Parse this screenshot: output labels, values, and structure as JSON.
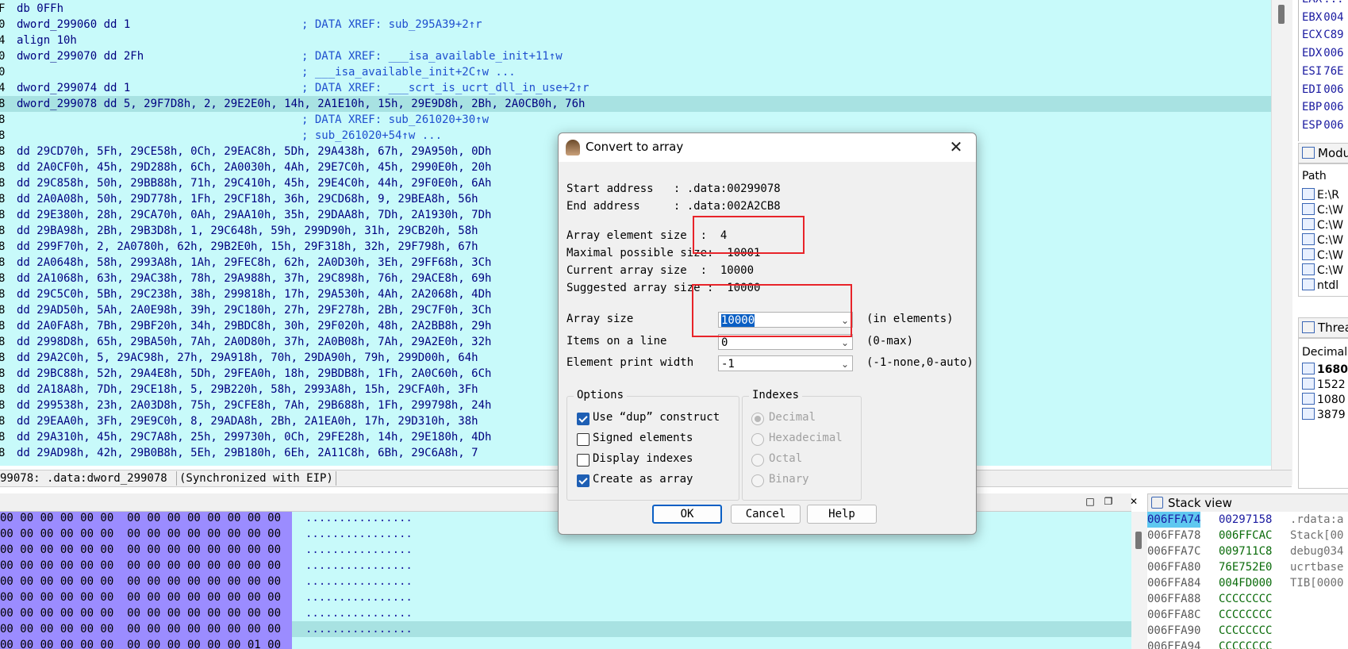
{
  "disasm": {
    "lines": [
      {
        "addr": "F",
        "code": "db 0FFh",
        "comment": ""
      },
      {
        "addr": "0",
        "code": "dword_299060 dd 1",
        "comment": "; DATA XREF: sub_295A39+2↑r"
      },
      {
        "addr": "4",
        "code": "align 10h",
        "comment": ""
      },
      {
        "addr": "0",
        "code": "dword_299070 dd 2Fh",
        "comment": "; DATA XREF: ___isa_available_init+11↑w"
      },
      {
        "addr": "0",
        "code": "",
        "comment": "; ___isa_available_init+2C↑w ..."
      },
      {
        "addr": "4",
        "code": "dword_299074 dd 1",
        "comment": "; DATA XREF: ___scrt_is_ucrt_dll_in_use+2↑r"
      },
      {
        "addr": "8",
        "code": "dword_299078 dd 5, 29F7D8h, 2, 29E2E0h, 14h, 2A1E10h, 15h, 29E9D8h, 2Bh, 2A0CB0h, 76h",
        "comment": ""
      },
      {
        "addr": "8",
        "code": "",
        "comment": "; DATA XREF: sub_261020+30↑w"
      },
      {
        "addr": "8",
        "code": "",
        "comment": "; sub_261020+54↑w ..."
      },
      {
        "addr": "8",
        "code": "dd 29CD70h, 5Fh, 29CE58h, 0Ch, 29EAC8h, 5Dh, 29A438h, 67h, 29A950h, 0Dh",
        "comment": ""
      },
      {
        "addr": "8",
        "code": "dd 2A0CF0h, 45h, 29D288h, 6Ch, 2A0030h, 4Ah, 29E7C0h, 45h, 2990E0h, 20h",
        "comment": ""
      },
      {
        "addr": "8",
        "code": "dd 29C858h, 50h, 29BB88h, 71h, 29C410h, 45h, 29E4C0h, 44h, 29F0E0h, 6Ah",
        "comment": ""
      },
      {
        "addr": "8",
        "code": "dd 2A0A08h, 50h, 29D778h, 1Fh, 29CF18h, 36h, 29CD68h, 9, 29BEA8h, 56h",
        "comment": ""
      },
      {
        "addr": "8",
        "code": "dd 29E380h, 28h, 29CA70h, 0Ah, 29AA10h, 35h, 29DAA8h, 7Dh, 2A1930h, 7Dh",
        "comment": ""
      },
      {
        "addr": "8",
        "code": "dd 29BA98h, 2Bh, 29B3D8h, 1, 29C648h, 59h, 299D90h, 31h, 29CB20h, 58h",
        "comment": ""
      },
      {
        "addr": "8",
        "code": "dd 299F70h, 2, 2A0780h, 62h, 29B2E0h, 15h, 29F318h, 32h, 29F798h, 67h",
        "comment": ""
      },
      {
        "addr": "8",
        "code": "dd 2A0648h, 58h, 2993A8h, 1Ah, 29FEC8h, 62h, 2A0D30h, 3Eh, 29FF68h, 3Ch",
        "comment": ""
      },
      {
        "addr": "8",
        "code": "dd 2A1068h, 63h, 29AC38h, 78h, 29A988h, 37h, 29C898h, 76h, 29ACE8h, 69h",
        "comment": ""
      },
      {
        "addr": "8",
        "code": "dd 29C5C0h, 5Bh, 29C238h, 38h, 299818h, 17h, 29A530h, 4Ah, 2A2068h, 4Dh",
        "comment": ""
      },
      {
        "addr": "8",
        "code": "dd 29AD50h, 5Ah, 2A0E98h, 39h, 29C180h, 27h, 29F278h, 2Bh, 29C7F0h, 3Ch",
        "comment": ""
      },
      {
        "addr": "8",
        "code": "dd 2A0FA8h, 7Bh, 29BF20h, 34h, 29BDC8h, 30h, 29F020h, 48h, 2A2BB8h, 29h",
        "comment": ""
      },
      {
        "addr": "8",
        "code": "dd 2998D8h, 65h, 29BA50h, 7Ah, 2A0D80h, 37h, 2A0B08h, 7Ah, 29A2E0h, 32h",
        "comment": ""
      },
      {
        "addr": "8",
        "code": "dd 29A2C0h, 5, 29AC98h, 27h, 29A918h, 70h, 29DA90h, 79h, 299D00h, 64h",
        "comment": ""
      },
      {
        "addr": "8",
        "code": "dd 29BC88h, 52h, 29A4E8h, 5Dh, 29FEA0h, 18h, 29BDB8h, 1Fh, 2A0C60h, 6Ch",
        "comment": ""
      },
      {
        "addr": "8",
        "code": "dd 2A18A8h, 7Dh, 29CE18h, 5, 29B220h, 58h, 2993A8h, 15h, 29CFA0h, 3Fh",
        "comment": ""
      },
      {
        "addr": "8",
        "code": "dd 299538h, 23h, 2A03D8h, 75h, 29CFE8h, 7Ah, 29B688h, 1Fh, 299798h, 24h",
        "comment": ""
      },
      {
        "addr": "8",
        "code": "dd 29EAA0h, 3Fh, 29E9C0h, 8, 29ADA8h, 2Bh, 2A1EA0h, 17h, 29D310h, 38h",
        "comment": ""
      },
      {
        "addr": "8",
        "code": "dd 29A310h, 45h, 29C7A8h, 25h, 299730h, 0Ch, 29FE28h, 14h, 29E180h, 4Dh",
        "comment": ""
      },
      {
        "addr": "8",
        "code": "dd 29AD98h, 42h, 29B0B8h, 5Eh, 29B180h, 6Eh, 2A11C8h, 6Bh, 29C6A8h, 7",
        "comment": ""
      }
    ],
    "highlight_index": 6
  },
  "status": {
    "location": "99078: .data:dword_299078",
    "sync": "(Synchronized with EIP)"
  },
  "registers": [
    {
      "name": "EAX",
      "value": "..."
    },
    {
      "name": "EBX",
      "value": "004"
    },
    {
      "name": "ECX",
      "value": "C89"
    },
    {
      "name": "EDX",
      "value": "006"
    },
    {
      "name": "ESI",
      "value": "76E"
    },
    {
      "name": "EDI",
      "value": "006"
    },
    {
      "name": "EBP",
      "value": "006"
    },
    {
      "name": "ESP",
      "value": "006"
    }
  ],
  "modules": {
    "title": "Modul",
    "column": "Path",
    "rows": [
      "E:\\R",
      "C:\\W",
      "C:\\W",
      "C:\\W",
      "C:\\W",
      "C:\\W",
      "ntdl"
    ]
  },
  "threads": {
    "title": "Threa",
    "column": "Decimal",
    "rows": [
      "1680",
      "1522",
      "1080",
      "3879"
    ]
  },
  "hexview": {
    "rows": [
      {
        "bytes": "00 00 00 00 00 00  00 00 00 00 00 00 00 00",
        "ascii": "................"
      },
      {
        "bytes": "00 00 00 00 00 00  00 00 00 00 00 00 00 00",
        "ascii": "................"
      },
      {
        "bytes": "00 00 00 00 00 00  00 00 00 00 00 00 00 00",
        "ascii": "................"
      },
      {
        "bytes": "00 00 00 00 00 00  00 00 00 00 00 00 00 00",
        "ascii": "................"
      },
      {
        "bytes": "00 00 00 00 00 00  00 00 00 00 00 00 00 00",
        "ascii": "................"
      },
      {
        "bytes": "00 00 00 00 00 00  00 00 00 00 00 00 00 00",
        "ascii": "................"
      },
      {
        "bytes": "00 00 00 00 00 00  00 00 00 00 00 00 00 00",
        "ascii": "................"
      },
      {
        "bytes": "00 00 00 00 00 00  00 00 00 00 00 00 00 00",
        "ascii": "................"
      },
      {
        "bytes": "00 00 00 00 00 00  00 00 00 00 00 00 01 00",
        "ascii": ""
      }
    ],
    "highlight_index": 7
  },
  "stack": {
    "title": "Stack view",
    "rows": [
      {
        "addr": "006FFA74",
        "value": "00297158",
        "comment": ".rdata:a"
      },
      {
        "addr": "006FFA78",
        "value": "006FFCAC",
        "comment": "Stack[00"
      },
      {
        "addr": "006FFA7C",
        "value": "009711C8",
        "comment": "debug034"
      },
      {
        "addr": "006FFA80",
        "value": "76E752E0",
        "comment": "ucrtbase"
      },
      {
        "addr": "006FFA84",
        "value": "004FD000",
        "comment": "TIB[0000"
      },
      {
        "addr": "006FFA88",
        "value": "CCCCCCCC",
        "comment": ""
      },
      {
        "addr": "006FFA8C",
        "value": "CCCCCCCC",
        "comment": ""
      },
      {
        "addr": "006FFA90",
        "value": "CCCCCCCC",
        "comment": ""
      },
      {
        "addr": "006FFA94",
        "value": "CCCCCCCC",
        "comment": ""
      }
    ]
  },
  "dialog": {
    "title": "Convert to array",
    "info": [
      "Start address   : .data:00299078",
      "End address     : .data:002A2CB8",
      "Array element size  :  4",
      "Maximal possible size:  10001",
      "Current array size  :  10000",
      "Suggested array size :  10000"
    ],
    "array_size_label": "Array size",
    "array_size_value": "10000",
    "array_size_hint": "(in elements)",
    "items_label": "Items on a line",
    "items_value": "0",
    "items_hint": "(0-max)",
    "width_label": "Element print width",
    "width_value": "-1",
    "width_hint": "(-1-none,0-auto)",
    "options_title": "Options",
    "options": [
      {
        "label": "Use “dup” construct",
        "checked": true
      },
      {
        "label": "Signed elements",
        "checked": false
      },
      {
        "label": "Display indexes",
        "checked": false
      },
      {
        "label": "Create as array",
        "checked": true
      }
    ],
    "indexes_title": "Indexes",
    "indexes": [
      {
        "label": "Decimal",
        "selected": true
      },
      {
        "label": "Hexadecimal",
        "selected": false
      },
      {
        "label": "Octal",
        "selected": false
      },
      {
        "label": "Binary",
        "selected": false
      }
    ],
    "ok": "OK",
    "cancel": "Cancel",
    "help": "Help",
    "close_glyph": "✕"
  },
  "hex_controls": {
    "restore": "□",
    "float": "❐",
    "close": "✕"
  },
  "colors": {
    "disasm_bg": "#c8fafa",
    "highlight": "#a8e2e2",
    "hex_sel": "#9b8cff",
    "annotation_red": "#e8242a",
    "stack_sel": "#5fc8f0"
  }
}
